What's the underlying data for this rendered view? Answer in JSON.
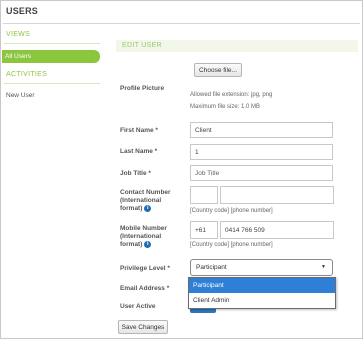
{
  "page": {
    "title": "USERS"
  },
  "sidebar": {
    "views_heading": "VIEWS",
    "views_items": [
      {
        "label": "All Users",
        "active": true
      }
    ],
    "activities_heading": "ACTIVITIES",
    "activities_items": [
      {
        "label": "New User"
      }
    ]
  },
  "form": {
    "heading": "EDIT USER",
    "profile_picture": {
      "label": "Profile Picture",
      "button": "Choose file...",
      "hint_extensions": "Allowed file extension: jpg, png",
      "hint_size": "Maximum file size: 1.0 MB"
    },
    "first_name": {
      "label": "First Name *",
      "value": "Client"
    },
    "last_name": {
      "label": "Last Name *",
      "value": "1"
    },
    "job_title": {
      "label": "Job Title *",
      "placeholder": "Job Title"
    },
    "contact_number": {
      "label_line1": "Contact Number",
      "label_line2": "(International",
      "label_line3": "format)",
      "country_code": "",
      "phone": "",
      "hint": "[Country code] [phone number]"
    },
    "mobile_number": {
      "label_line1": "Mobile Number",
      "label_line2": "(International",
      "label_line3": "format)",
      "country_code": "+61",
      "phone": "0414 766 509",
      "hint": "[Country code] [phone number]"
    },
    "privilege_level": {
      "label": "Privilege Level *",
      "selected": "Participant",
      "options": [
        "Participant",
        "Client Admin"
      ]
    },
    "email": {
      "label": "Email Address *"
    },
    "user_active": {
      "label": "User Active"
    },
    "save_button": "Save Changes"
  },
  "colors": {
    "accent_green": "#8cc63f",
    "select_blue": "#2f7fd6",
    "info_blue": "#1f6fb5"
  },
  "icons": {
    "info": "info-icon",
    "dropdown": "caret-down-icon"
  }
}
